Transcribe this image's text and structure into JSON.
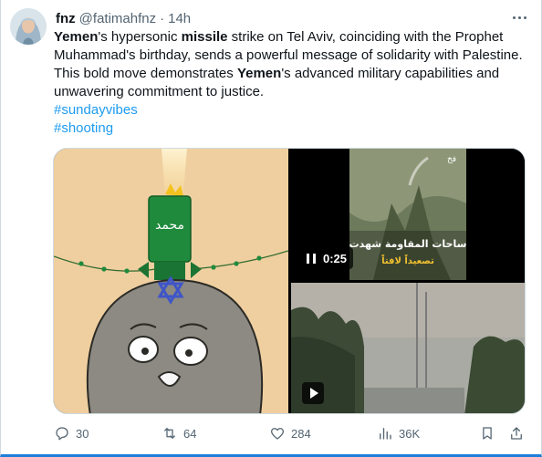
{
  "tweet": {
    "author_name": "fnz",
    "handle": "@fatimahfnz",
    "separator": "·",
    "time": "14h",
    "text": {
      "w1": "Yemen",
      "t1": "'s hypersonic ",
      "w2": "missile",
      "t2": " strike on Tel Aviv, coinciding with the Prophet Muhammad's birthday, sends a powerful message of solidarity with Palestine. This bold move demonstrates ",
      "w3": "Yemen",
      "t3": "'s advanced military capabilities and unwavering commitment to justice."
    },
    "hashtags": [
      "#sundayvibes",
      "#shooting"
    ]
  },
  "media": {
    "video1": {
      "duration": "0:25",
      "overlay_line1": "ساحات المقاومة شهدت",
      "overlay_line2": "تصعيداً لافتاً",
      "channel_logo": "فخ"
    },
    "cartoon_label": "محمد"
  },
  "actions": {
    "replies": "30",
    "reposts": "64",
    "likes": "284",
    "views": "36K"
  },
  "icons": [
    "reply-icon",
    "repost-icon",
    "like-icon",
    "views-icon",
    "bookmark-icon",
    "share-icon",
    "more-icon",
    "pause-icon",
    "play-icon"
  ],
  "colors": {
    "hashtag": "#1d9bf0",
    "secondary_text": "#536471",
    "border": "#cfd9de",
    "focus_line": "#1d7ed8"
  }
}
